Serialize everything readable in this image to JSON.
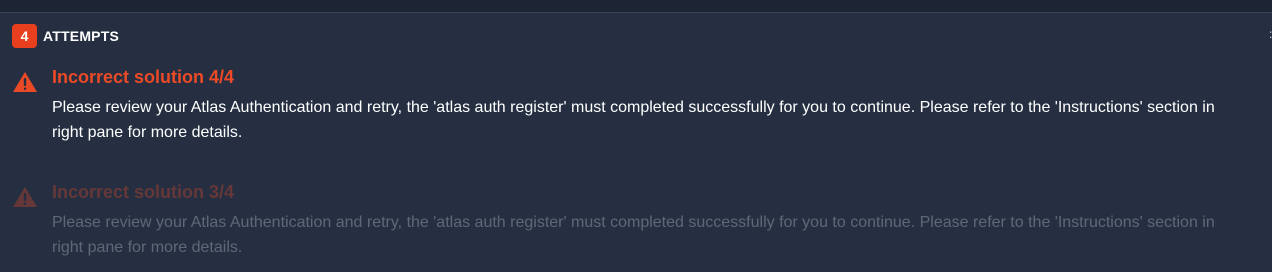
{
  "header": {
    "count": "4",
    "label": "ATTEMPTS"
  },
  "attempts": [
    {
      "title": "Incorrect solution 4/4",
      "message": "Please review your Atlas Authentication and retry, the 'atlas auth register' must completed successfully for you to continue. Please refer to the 'Instructions' section in right pane for more details.",
      "icon": "warning-triangle-icon"
    },
    {
      "title": "Incorrect solution 3/4",
      "message": "Please review your Atlas Authentication and retry, the 'atlas auth register' must completed successfully for you to continue. Please refer to the 'Instructions' section in right pane for more details.",
      "icon": "warning-triangle-icon"
    }
  ],
  "colors": {
    "background": "#252f41",
    "accent": "#ec4a26",
    "badge": "#e8401e"
  }
}
